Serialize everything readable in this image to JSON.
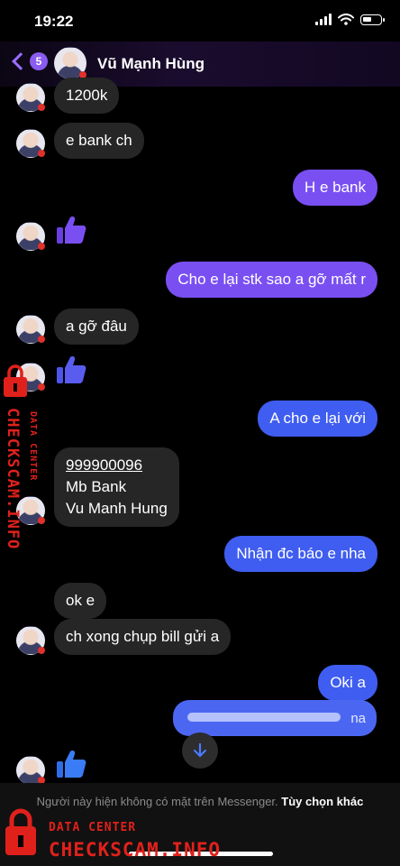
{
  "status": {
    "time": "19:22"
  },
  "header": {
    "back_badge": "5",
    "contact_name": "Vũ Mạnh Hùng"
  },
  "messages": [
    {
      "side": "in",
      "text": "1200k"
    },
    {
      "side": "in",
      "text": "e bank ch"
    },
    {
      "side": "out",
      "text": "H e bank"
    },
    {
      "side": "in",
      "type": "like"
    },
    {
      "side": "out",
      "text": "Cho e lại stk sao a gỡ mất r"
    },
    {
      "side": "in",
      "text": "a gỡ đâu"
    },
    {
      "side": "in",
      "type": "like"
    },
    {
      "side": "out",
      "text": "A cho e lại với"
    },
    {
      "side": "in",
      "lines": [
        "999900096",
        "Mb Bank",
        "Vu Manh Hung"
      ]
    },
    {
      "side": "out",
      "text": "Nhận đc báo e nha"
    },
    {
      "side": "in",
      "text": "ok e"
    },
    {
      "side": "in",
      "text": "ch xong chụp bill gửi a"
    },
    {
      "side": "out",
      "text": "Oki a"
    },
    {
      "side": "out",
      "text": "na",
      "redacted": true
    },
    {
      "side": "in",
      "type": "like"
    }
  ],
  "footer": {
    "notice": "Người này hiện không có mặt trên Messenger.",
    "action": "Tùy chọn khác"
  },
  "watermark": {
    "label": "DATA CENTER",
    "site": "CHECKSCAM.INFO"
  },
  "colors": {
    "outgoing_purple": "#7a4ff2",
    "outgoing_blue": "#3f5df0",
    "incoming": "#262626",
    "watermark_red": "#e0211b",
    "accent": "#9b6cff"
  },
  "icons": [
    "back-chevron-icon",
    "thumbs-up-icon",
    "arrow-down-icon",
    "lock-icon",
    "wifi-icon",
    "battery-icon",
    "signal-icon"
  ]
}
